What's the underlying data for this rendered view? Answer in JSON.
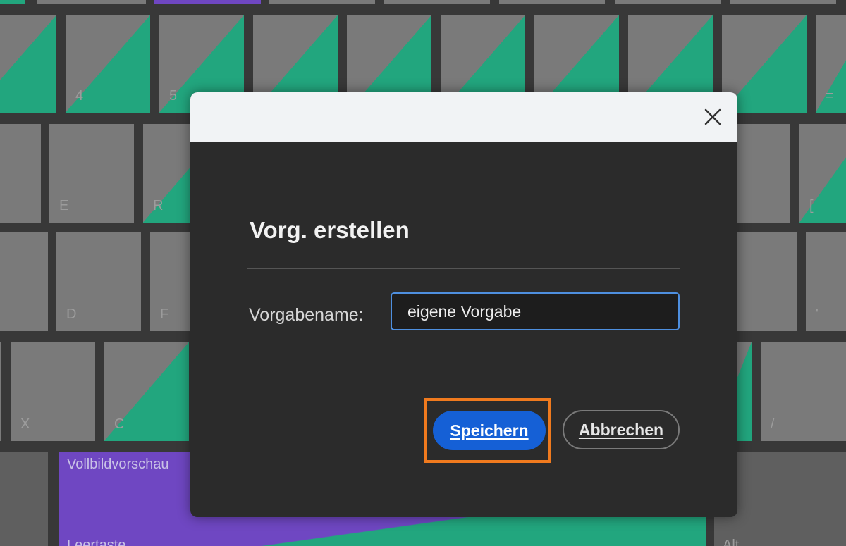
{
  "keyboard": {
    "keys": [
      "4",
      "5",
      "E",
      "R",
      "[",
      "D",
      "F",
      "'",
      "X",
      "C",
      "/",
      "Vollbildvorschau",
      "Leertaste",
      "Alt",
      "="
    ]
  },
  "dialog": {
    "title": "Vorg. erstellen",
    "field_label": "Vorgabename:",
    "field_value": "eigene Vorgabe",
    "save_label": "Speichern",
    "cancel_label": "Abbrechen",
    "close_icon": "close-icon"
  },
  "colors": {
    "accent_blue": "#1560d6",
    "highlight_orange": "#f07a1e",
    "key_green": "#22a67e",
    "key_purple": "#6f47c2",
    "key_gray": "#7a7a7a"
  }
}
